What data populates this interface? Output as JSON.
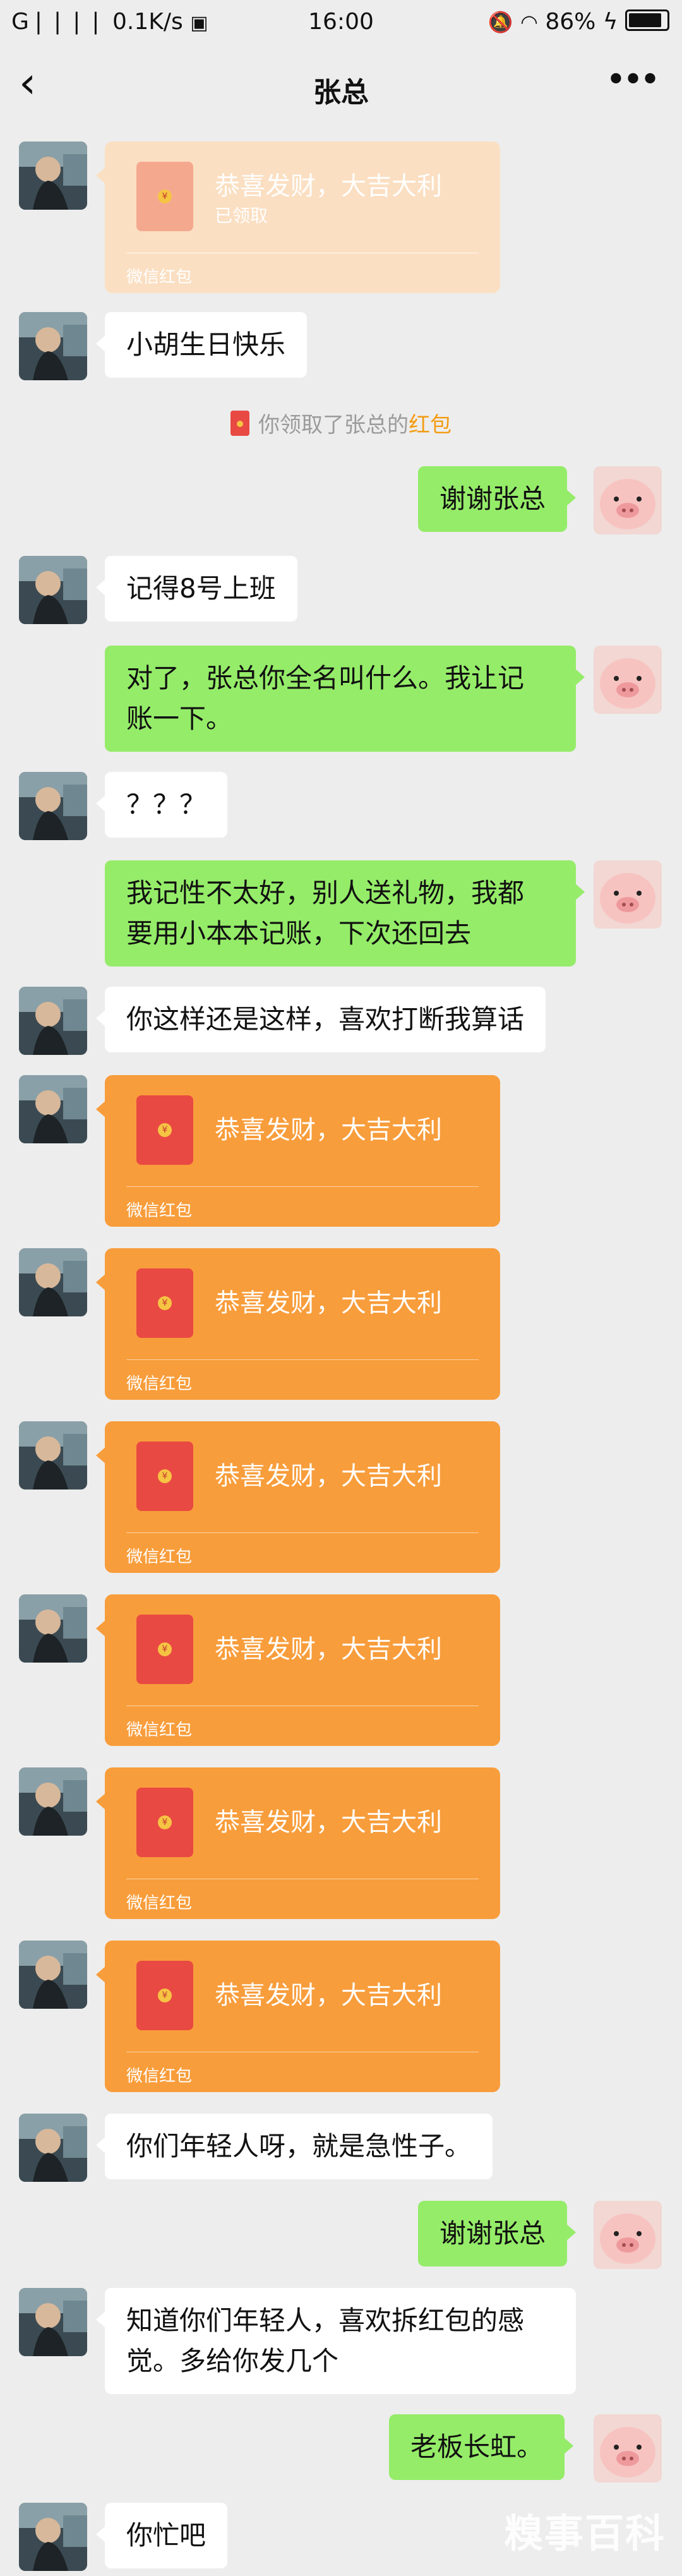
{
  "status_bar": {
    "signal": "G❘❘❘❘",
    "speed": "0.1K/s",
    "time": "16:00",
    "battery": "86%"
  },
  "header": {
    "title": "张总"
  },
  "messages": [
    {
      "type": "redpacket",
      "side": "left",
      "text": "恭喜发财，大吉大利",
      "sub": "已领取",
      "label": "微信红包"
    },
    {
      "type": "text",
      "side": "left",
      "text": "小胡生日快乐"
    },
    {
      "type": "system",
      "prefix": "你领取了张总的",
      "link": "红包"
    },
    {
      "type": "text",
      "side": "right",
      "text": "谢谢张总"
    },
    {
      "type": "text",
      "side": "left",
      "text": "记得8号上班"
    },
    {
      "type": "text",
      "side": "right",
      "line1": "对了，张总你全名叫什么。我让记",
      "line2": "账一下。"
    },
    {
      "type": "text",
      "side": "left",
      "text": "？？？"
    },
    {
      "type": "text",
      "side": "right",
      "line1": "我记性不太好，别人送礼物，我都",
      "line2": "要用小本本记账，下次还回去"
    },
    {
      "type": "text",
      "side": "left",
      "text": "你这样还是这样，喜欢打断我算话"
    },
    {
      "type": "redpacket",
      "side": "left",
      "text": "恭喜发财，大吉大利",
      "label": "微信红包"
    },
    {
      "type": "redpacket",
      "side": "left",
      "text": "恭喜发财，大吉大利",
      "label": "微信红包"
    },
    {
      "type": "redpacket",
      "side": "left",
      "text": "恭喜发财，大吉大利",
      "label": "微信红包"
    },
    {
      "type": "redpacket",
      "side": "left",
      "text": "恭喜发财，大吉大利",
      "label": "微信红包"
    },
    {
      "type": "redpacket",
      "side": "left",
      "text": "恭喜发财，大吉大利",
      "label": "微信红包"
    },
    {
      "type": "redpacket",
      "side": "left",
      "text": "恭喜发财，大吉大利",
      "label": "微信红包"
    },
    {
      "type": "text",
      "side": "left",
      "text": "你们年轻人呀，就是急性子。"
    },
    {
      "type": "text",
      "side": "right",
      "text": "谢谢张总"
    },
    {
      "type": "text",
      "side": "left",
      "line1": "知道你们年轻人，喜欢拆红包的感",
      "line2": "觉。多给你发几个"
    },
    {
      "type": "text",
      "side": "right",
      "text": "老板长虹。"
    },
    {
      "type": "text",
      "side": "left",
      "text": "你忙吧"
    }
  ],
  "watermark": "糗事百科"
}
